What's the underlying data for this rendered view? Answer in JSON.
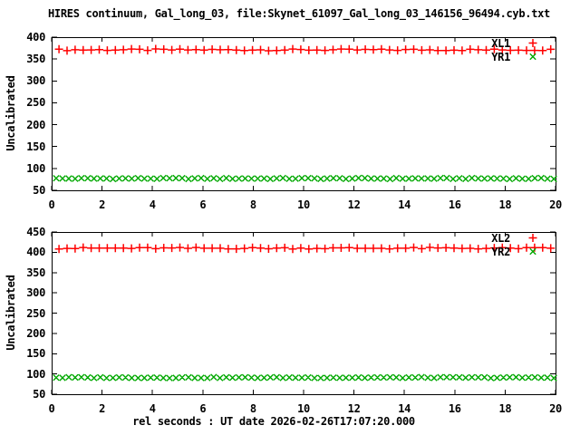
{
  "title": "HIRES continuum, Gal_long_03, file:Skynet_61097_Gal_long_03_146156_96494.cyb.txt",
  "xlabel": "rel seconds : UT date 2026-02-26T17:07:20.000",
  "colors": {
    "background": "#ffffff",
    "frame": "#000000",
    "text": "#000000",
    "series_xl": "#ff0000",
    "series_yr": "#00a800"
  },
  "chart_data": [
    {
      "type": "scatter",
      "panel": "top",
      "ylabel": "Uncalibrated",
      "xlim": [
        0,
        20
      ],
      "ylim": [
        50,
        400
      ],
      "xticks": [
        0,
        2,
        4,
        6,
        8,
        10,
        12,
        14,
        16,
        18,
        20
      ],
      "yticks": [
        50,
        100,
        150,
        200,
        250,
        300,
        350,
        400
      ],
      "grid": false,
      "legend_position": "top-right-inside",
      "series": [
        {
          "name": "XL1",
          "marker": "plus",
          "color": "#ff0000",
          "x_start": 0.29,
          "x_step": 0.32,
          "x_end": 19.81,
          "n_points": 62,
          "y_mean": 371,
          "y_scatter": 2,
          "description": "flat constant level ~371 uncalibrated counts"
        },
        {
          "name": "YR1",
          "marker": "x",
          "color": "#00a800",
          "x_start": 0.18,
          "x_step": 0.25,
          "x_end": 19.93,
          "n_points": 80,
          "y_mean": 77,
          "y_scatter": 1.2,
          "description": "flat constant level ~77 uncalibrated counts"
        }
      ]
    },
    {
      "type": "scatter",
      "panel": "bottom",
      "ylabel": "Uncalibrated",
      "xlim": [
        0,
        20
      ],
      "ylim": [
        50,
        450
      ],
      "xticks": [
        0,
        2,
        4,
        6,
        8,
        10,
        12,
        14,
        16,
        18,
        20
      ],
      "yticks": [
        50,
        100,
        150,
        200,
        250,
        300,
        350,
        400,
        450
      ],
      "grid": false,
      "legend_position": "top-right-inside",
      "series": [
        {
          "name": "XL2",
          "marker": "plus",
          "color": "#ff0000",
          "x_start": 0.29,
          "x_step": 0.32,
          "x_end": 19.81,
          "n_points": 62,
          "y_mean": 410,
          "y_scatter": 2,
          "description": "flat constant level ~410 uncalibrated counts"
        },
        {
          "name": "YR2",
          "marker": "x",
          "color": "#00a800",
          "x_start": 0.18,
          "x_step": 0.25,
          "x_end": 19.93,
          "n_points": 80,
          "y_mean": 91,
          "y_scatter": 1.2,
          "description": "flat constant level ~91 uncalibrated counts"
        }
      ]
    }
  ]
}
